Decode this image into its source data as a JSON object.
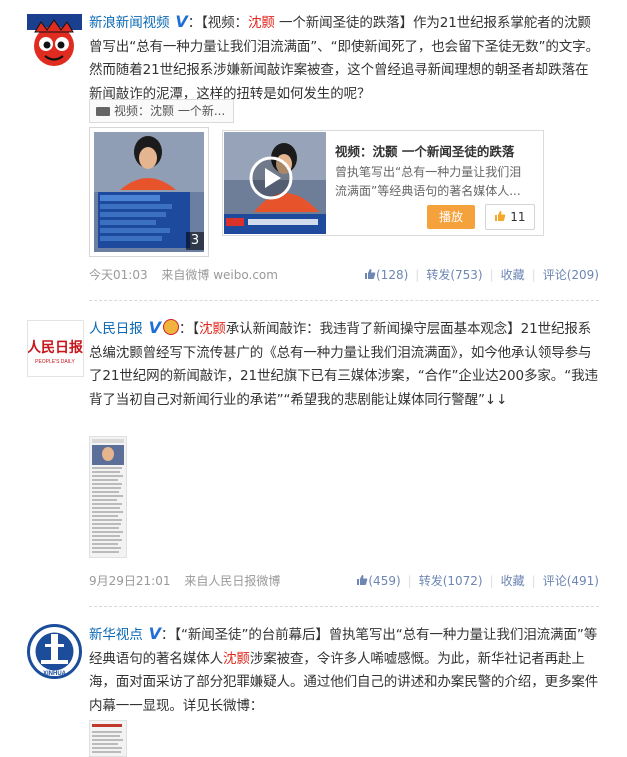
{
  "colors": {
    "link": "#0a68b4",
    "highlight": "#e0261b",
    "meta_gray": "#999999",
    "action_blue": "#6d86b4",
    "play_orange": "#f5a13c"
  },
  "posts": [
    {
      "user": "新浪新闻视频",
      "verified_icon": "v-verified-icon",
      "colon": "：",
      "text_a": "【视频：",
      "text_hl": "沈颢",
      "text_b": " 一个新闻圣徒的跌落】作为21世纪报系掌舵者的沈颢曾写出“总有一种力量让我们泪流满面”、“即使新闻死了，也会留下圣徒无数”的文字。然而随着21世纪报系涉嫌新闻敲诈案被查，这个曾经追寻新闻理想的朝圣者却跌落在新闻敲诈的泥潭，这样的扭转是如何发生的呢？",
      "video_tag": "视频：沈颢 一个新...",
      "thumb_count": "3",
      "card_title": "视频：沈颢 一个新闻圣徒的跌落",
      "card_desc": "曾执笔写出“总有一种力量让我们泪流满面”等经典语句的著名媒体人...",
      "play_label": "播放",
      "card_likes": "11",
      "time": "今天01:03",
      "source": "来自微博 weibo.com",
      "likes": "(128)",
      "repost": "转发(753)",
      "fav": "收藏",
      "comment": "评论(209)"
    },
    {
      "user": "人民日报",
      "verified_icon": "v-verified-icon",
      "colon": "：",
      "text_a": "【",
      "text_hl": "沈颢",
      "text_b": "承认新闻敲诈：我违背了新闻操守层面基本观念】21世纪报系总编沈颢曾经写下流传甚广的《总有一种力量让我们泪流满面》，如今他承认领导参与了21世纪网的新闻敲诈，21世纪旗下已有三媒体涉案，“合作”企业达200多家。“我违背了当初自己对新闻行业的承诺”“希望我的悲剧能让媒体同行警醒”↓↓",
      "time": "9月29日21:01",
      "source": "来自人民日报微博",
      "likes": "(459)",
      "repost": "转发(1072)",
      "fav": "收藏",
      "comment": "评论(491)"
    },
    {
      "user": "新华视点",
      "verified_icon": "v-verified-icon",
      "colon": "：",
      "text_a": "【“新闻圣徒”的台前幕后】曾执笔写出“总有一种力量让我们泪流满面”等经典语句的著名媒体人",
      "text_hl": "沈颢",
      "text_b": "涉案被查，令许多人唏嘘感慨。为此，新华社记者再赴上海，面对面采访了部分犯罪嫌疑人。通过他们自己的讲述和办案民警的介绍，更多案件内幕一一显现。详见长微博："
    }
  ],
  "avatars": {
    "p2_logo_text": "人民日报",
    "p2_logo_sub": "PEOPLE'S DAILY",
    "p3_logo_text": "XINHUA"
  }
}
